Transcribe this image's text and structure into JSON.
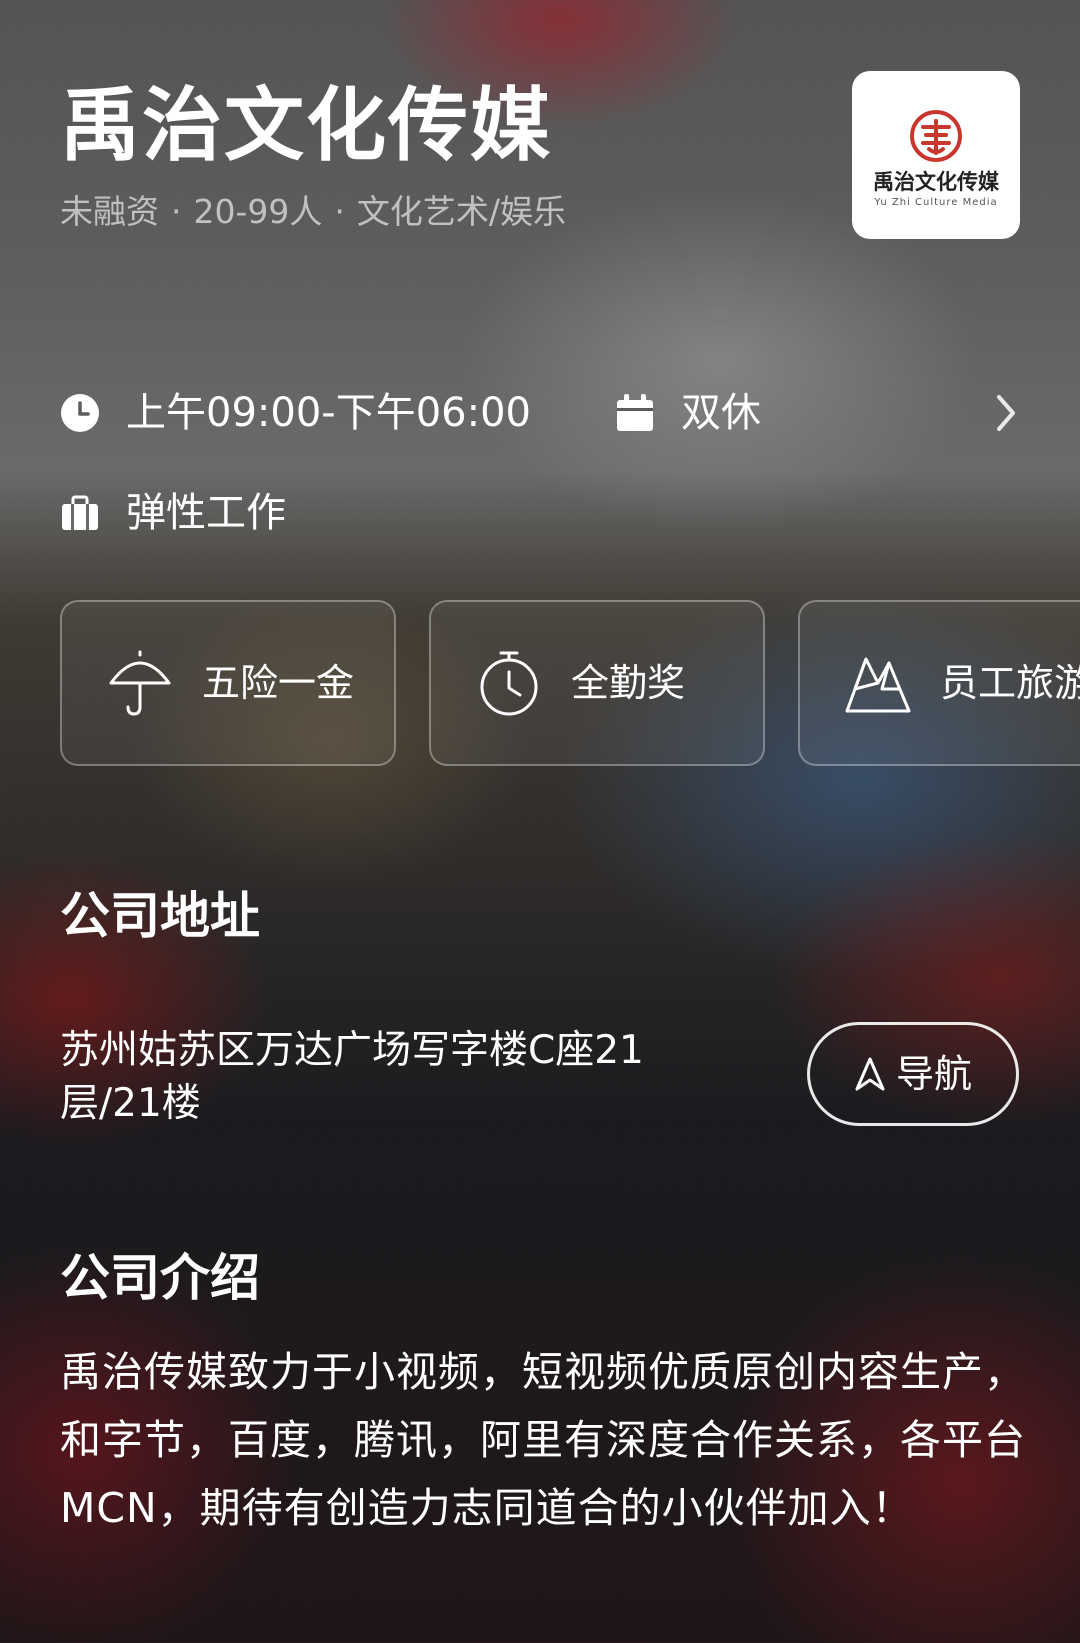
{
  "company": {
    "name": "禹治文化传媒",
    "meta": {
      "funding": "未融资",
      "size": "20-99人",
      "industry": "文化艺术/娱乐",
      "separator": "·"
    },
    "logo": {
      "icon": "yuzhi-seal-logo",
      "text_cn": "禹治文化传媒",
      "text_en": "Yu Zhi Culture Media",
      "accent_color": "#c8372d"
    }
  },
  "work_info": {
    "hours": {
      "icon": "clock-icon",
      "label": "上午09:00-下午06:00"
    },
    "rest": {
      "icon": "calendar-icon",
      "label": "双休"
    },
    "style": {
      "icon": "briefcase-icon",
      "label": "弹性工作"
    },
    "more_icon": "chevron-right-icon"
  },
  "benefits": [
    {
      "icon": "umbrella-icon",
      "label": "五险一金"
    },
    {
      "icon": "stopwatch-icon",
      "label": "全勤奖"
    },
    {
      "icon": "mountain-icon",
      "label": "员工旅游"
    }
  ],
  "address_section": {
    "title": "公司地址",
    "address": "苏州姑苏区万达广场写字楼C座21层/21楼",
    "nav_button": {
      "icon": "navigation-arrow-icon",
      "label": "导航"
    }
  },
  "intro_section": {
    "title": "公司介绍",
    "text": "禹治传媒致力于小视频，短视频优质原创内容生产，和字节，百度，腾讯，阿里有深度合作关系，各平台MCN，期待有创造力志同道合的小伙伴加入！"
  }
}
